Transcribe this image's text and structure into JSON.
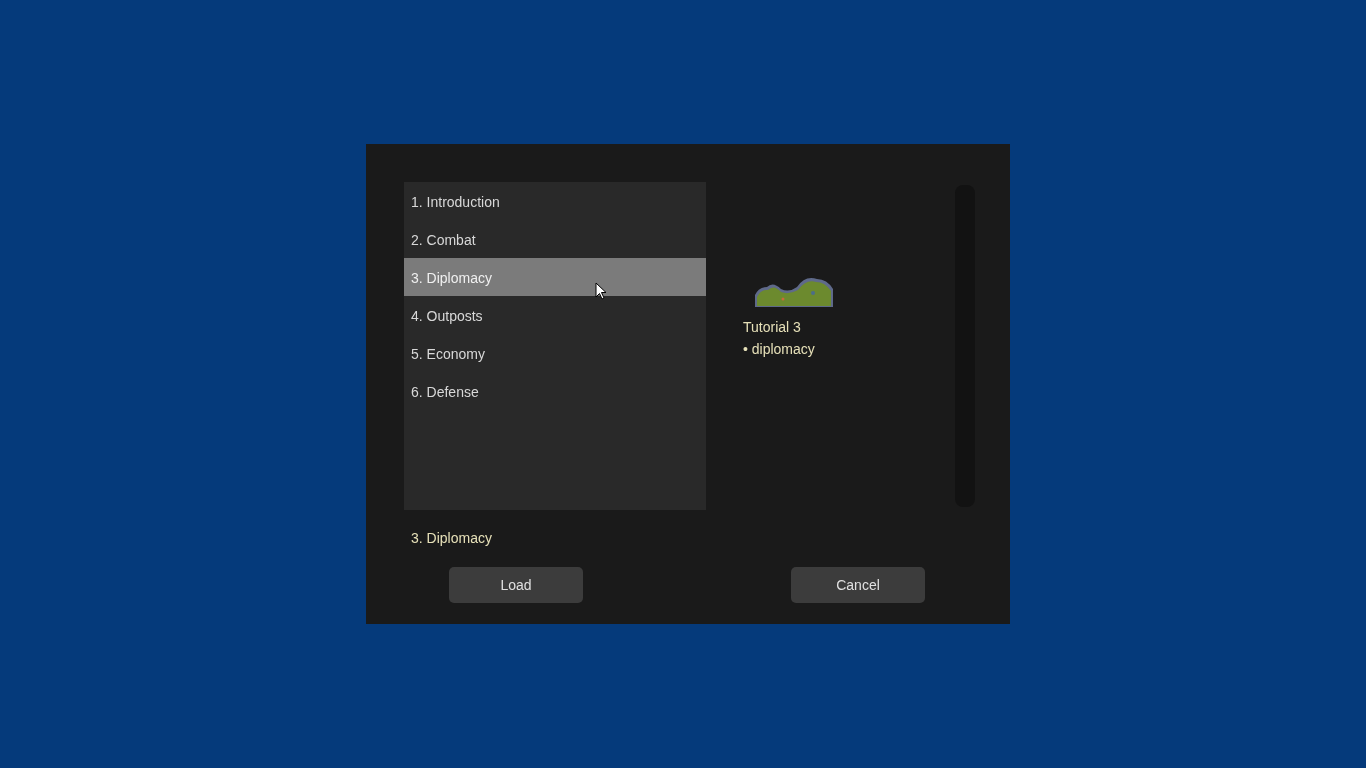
{
  "tutorial_list": {
    "items": [
      {
        "label": "1. Introduction",
        "selected": false
      },
      {
        "label": "2. Combat",
        "selected": false
      },
      {
        "label": "3. Diplomacy",
        "selected": true
      },
      {
        "label": "4. Outposts",
        "selected": false
      },
      {
        "label": "5. Economy",
        "selected": false
      },
      {
        "label": "6. Defense",
        "selected": false
      }
    ]
  },
  "preview": {
    "title": "Tutorial 3",
    "bullets": [
      "• diplomacy"
    ]
  },
  "selected_label": "3. Diplomacy",
  "buttons": [
    {
      "label": "Load"
    },
    {
      "label": "Cancel"
    }
  ]
}
